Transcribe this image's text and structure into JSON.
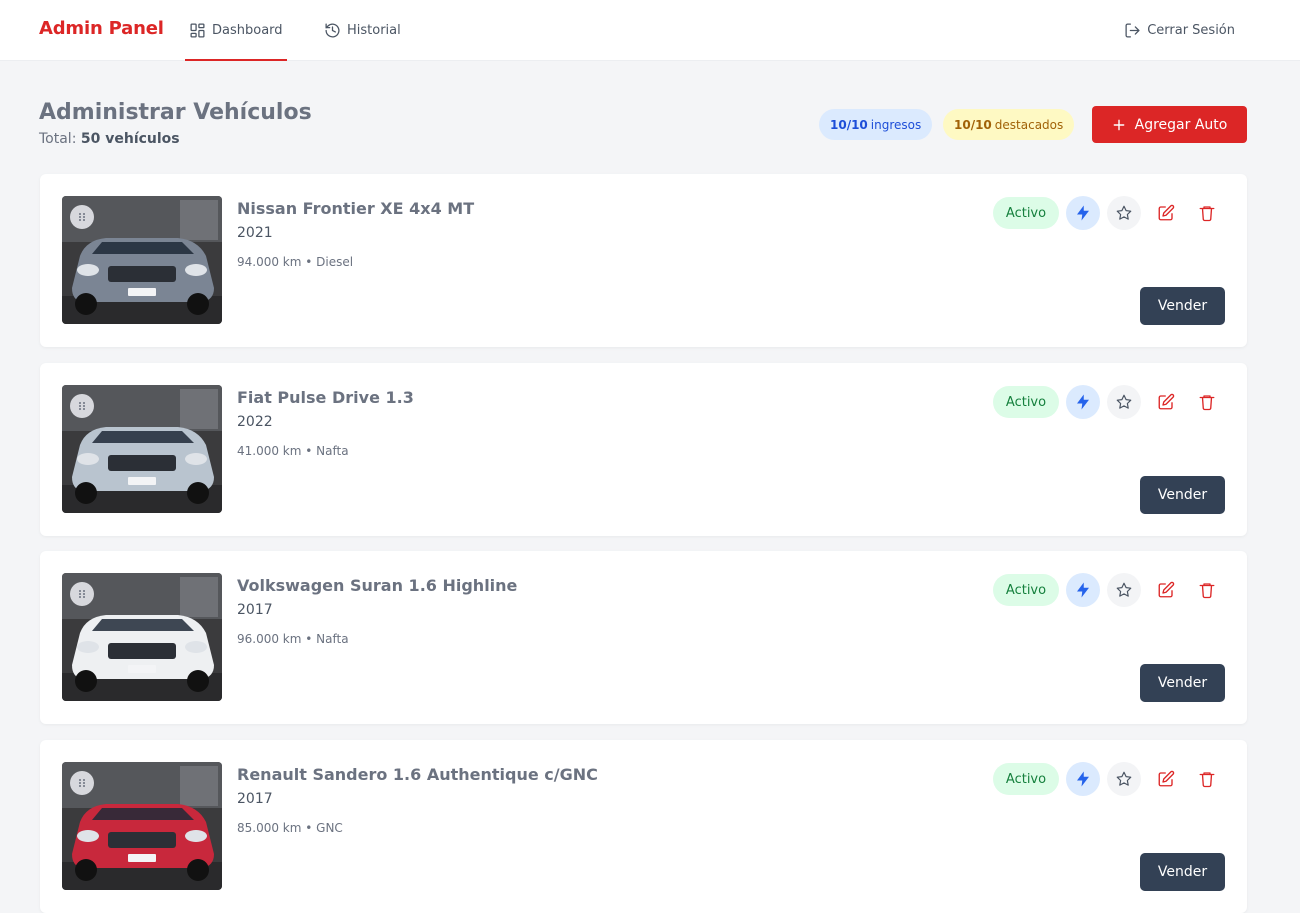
{
  "brand": "Admin Panel",
  "nav": [
    {
      "label": "Dashboard",
      "icon": "dashboard-icon",
      "active": true
    },
    {
      "label": "Historial",
      "icon": "history-icon",
      "active": false
    }
  ],
  "logout_label": "Cerrar Sesión",
  "page": {
    "title": "Administrar Vehículos",
    "total_prefix": "Total:",
    "total_value": "50 vehículos"
  },
  "badges": {
    "ingresos_count": "10/10",
    "ingresos_label": "ingresos",
    "destacados_count": "10/10",
    "destacados_label": "destacados"
  },
  "add_button_label": "Agregar Auto",
  "colors": {
    "accent": "#dc2626",
    "active_badge": "#dcfce7",
    "sell_button": "#334155"
  },
  "vehicles": [
    {
      "title": "Nissan Frontier XE 4x4 MT",
      "year": "2021",
      "meta": "94.000 km • Diesel",
      "status": "Activo",
      "sell_label": "Vender",
      "car_color": "#7b8594"
    },
    {
      "title": "Fiat Pulse Drive 1.3",
      "year": "2022",
      "meta": "41.000 km • Nafta",
      "status": "Activo",
      "sell_label": "Vender",
      "car_color": "#b9c4cf"
    },
    {
      "title": "Volkswagen Suran 1.6 Highline",
      "year": "2017",
      "meta": "96.000 km • Nafta",
      "status": "Activo",
      "sell_label": "Vender",
      "car_color": "#eef0f2"
    },
    {
      "title": "Renault Sandero 1.6 Authentique c/GNC",
      "year": "2017",
      "meta": "85.000 km • GNC",
      "status": "Activo",
      "sell_label": "Vender",
      "car_color": "#c8283c"
    }
  ]
}
